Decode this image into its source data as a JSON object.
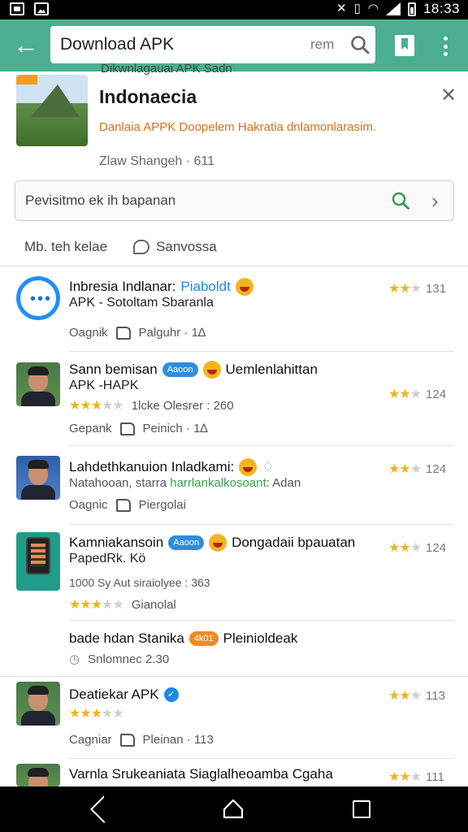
{
  "status_bar": {
    "time": "18:33"
  },
  "app_bar": {
    "search_value": "Download APK",
    "search_extra": "rem"
  },
  "header": {
    "top_line": "Dikwnlagauai APK Sadn",
    "title": "Indonaecia",
    "description": "Danlaia APPK Doopelem Hakratia dnlamonlarasim.",
    "meta": "Zlaw Shangeh · 611",
    "search_text": "Pevisitmo ek ih bapanan",
    "tab1": "Mb. teh kelae",
    "tab2": "Sanvossa"
  },
  "items": [
    {
      "title": "Inbresia Indlanar:",
      "title_highlight": "Piaboldt",
      "subtitle": "APK - Sotoltam Sbaranla",
      "meta_left": "Oagnik",
      "meta_action": "Palguhr · 1∆",
      "rating": "131"
    },
    {
      "title": "Sann bemisan",
      "pill": "Aaoon",
      "title_after": "Uemlenlahittan",
      "subtitle": "APK -HAPK",
      "meta_stars_text": "1lcke Olesrer : 260",
      "meta_left": "Gepank",
      "meta_action": "Peinich · 1∆",
      "rating": "124"
    },
    {
      "title": "Lahdethkanuion Inladkami:",
      "subtitle_a": "Natahooan, starra",
      "subtitle_green": "harrlankalkosoant",
      "subtitle_b": ": Adan",
      "meta_left": "Oagnic",
      "meta_action": "Piergolai",
      "rating": "124"
    },
    {
      "title": "Kamniakansoin",
      "pill": "Aaoon",
      "title_after": "Dongadaii bpauatan",
      "subtitle": "PapedRk. Kö",
      "meta_text": "1000 Sy Aut siraiolyee : 363",
      "meta_stars_text": "Gianolal",
      "rating": "124"
    },
    {
      "title": "bade hdan Stanika",
      "pill": "4k01",
      "title_after": "Pleinioldeak",
      "meta_text": "Snlomnec 2.30"
    },
    {
      "title": "Deatiekar APK",
      "meta_left": "Cagniar",
      "meta_action": "Pleinan · 113",
      "rating": "113"
    },
    {
      "title": "Varnla Srukeaniata Siaglalheoamba Cgaha",
      "rating": "111"
    }
  ],
  "colors": {
    "accent": "#4caf90",
    "star": "#f0b323",
    "link": "#1e88e5"
  }
}
